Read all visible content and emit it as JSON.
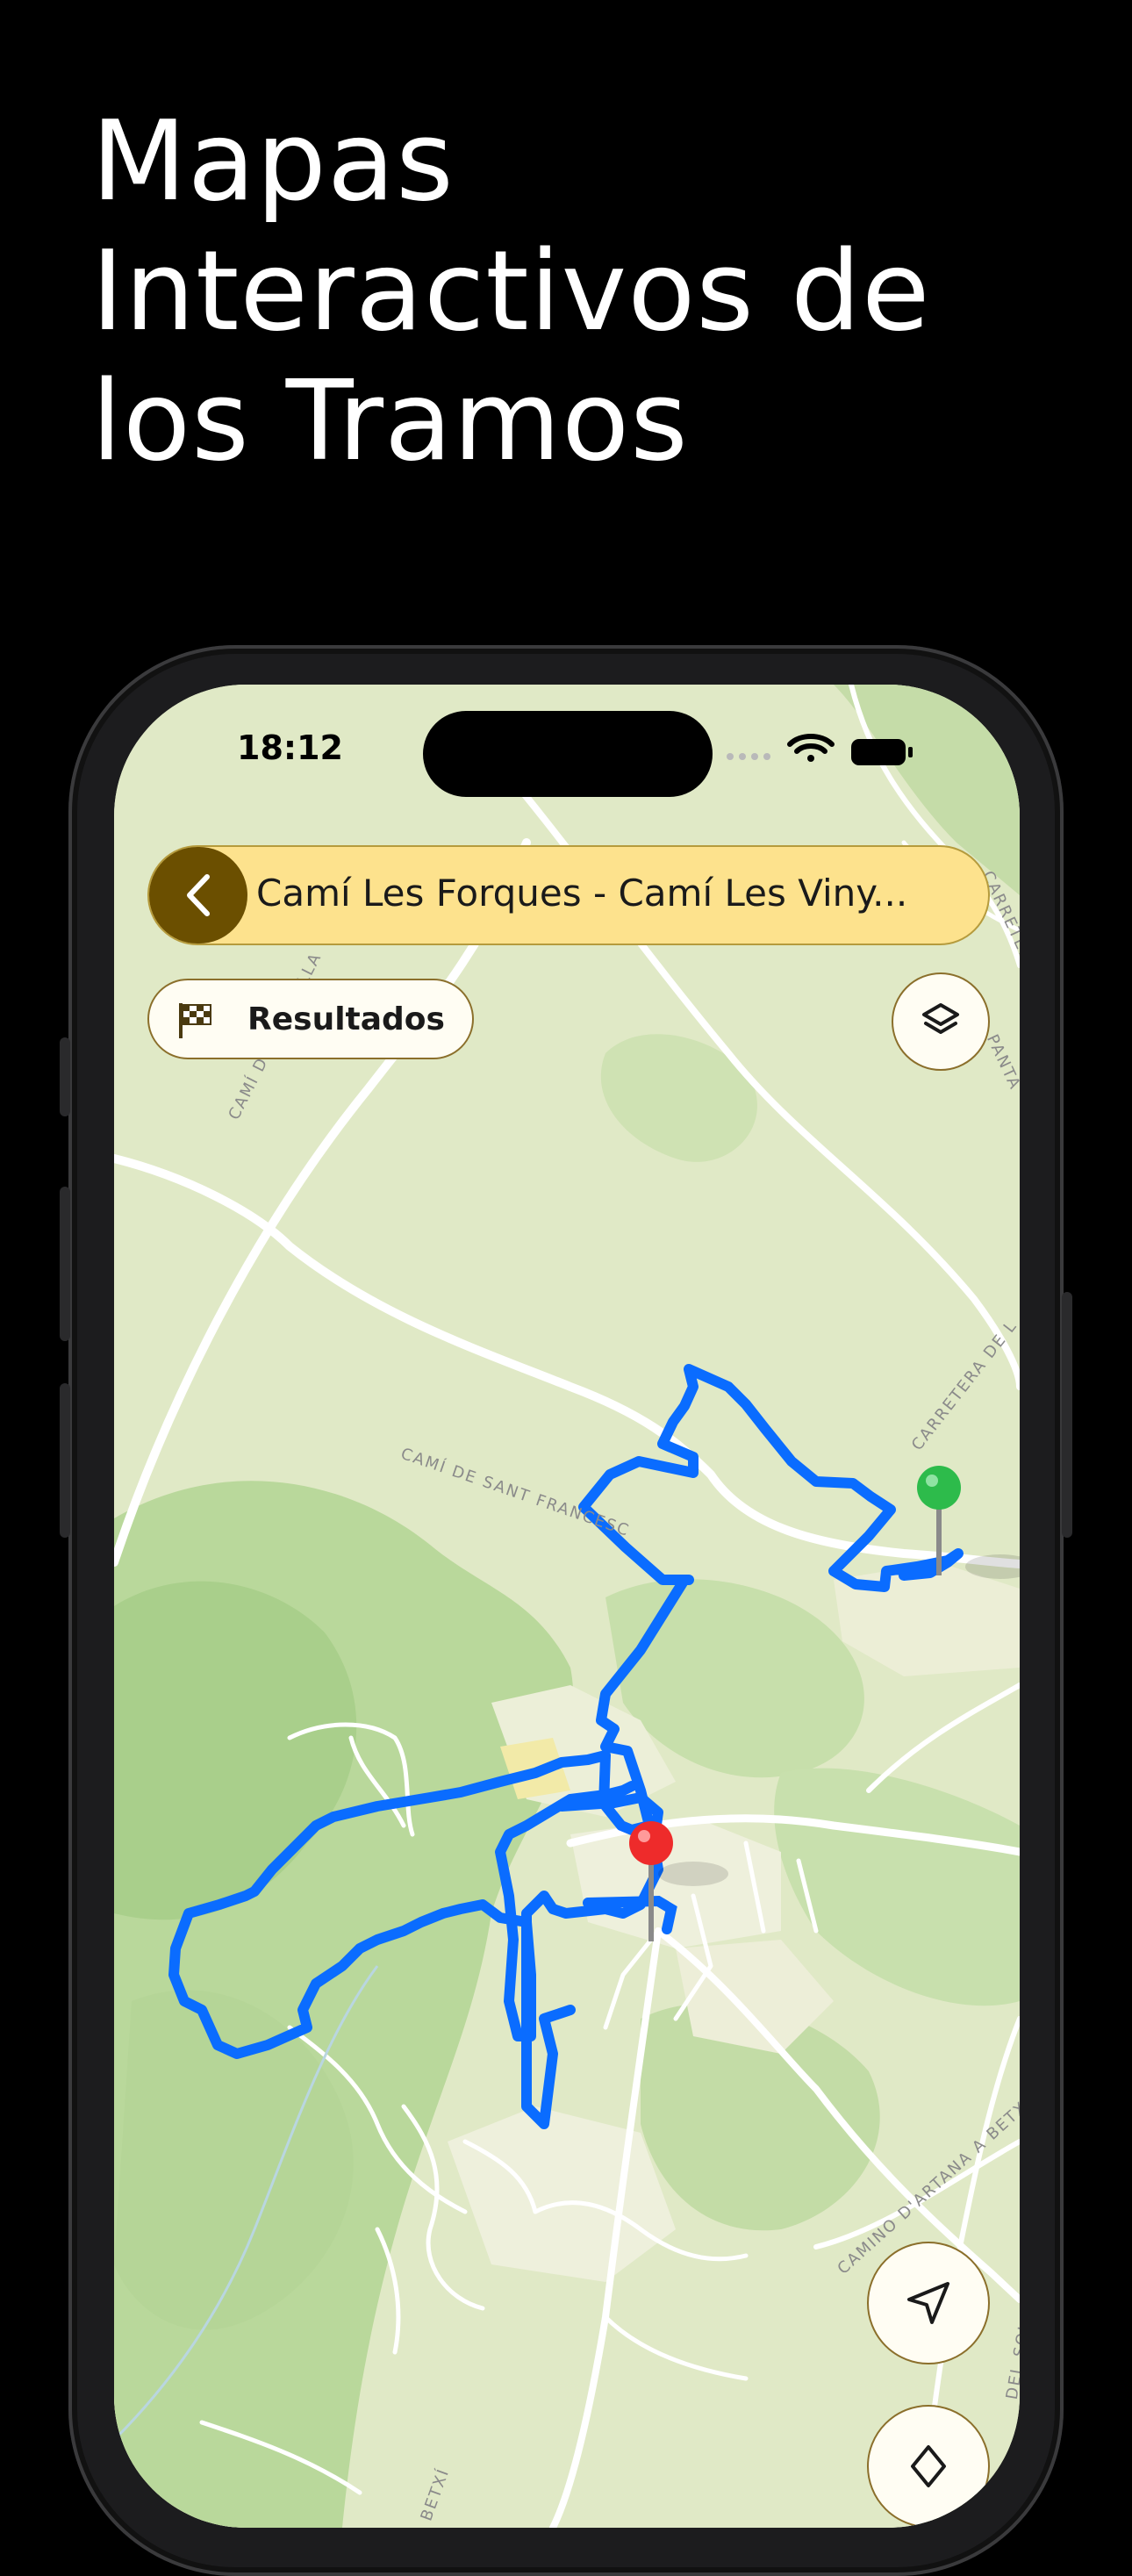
{
  "headline": {
    "line1": "Mapas",
    "line2": "Interactivos de",
    "line3": "los Tramos"
  },
  "status_bar": {
    "time": "18:12"
  },
  "top_bar": {
    "title": "Camí Les Forques - Camí Les Viny..."
  },
  "results_button": {
    "label": "Resultados"
  },
  "map": {
    "road_labels": {
      "cami_ratlla": "CAMÍ DE LA RATLLA",
      "cami_sant_francesc": "CAMÍ DE SANT FRANCESC",
      "carretera": "CARRETERA DE L",
      "carretera_top": "CARRETERA",
      "panta": "PANTA",
      "camino_artana": "CAMINO D'ARTANA A BETXÍ",
      "del_solaig": "DEL SOLAIG",
      "betxi": "A BETXÍ"
    },
    "route_color": "#0a6cff",
    "start_marker_color": "#2dbb4b",
    "end_marker_color": "#ee2b2b"
  },
  "icons": {
    "back": "chevron-left-icon",
    "results": "checkered-flag-icon",
    "layers": "layers-icon",
    "locate": "navigation-arrow-icon",
    "compass": "compass-icon"
  },
  "colors": {
    "accent_dark": "#6b4f00",
    "title_bg": "#fde28d"
  }
}
